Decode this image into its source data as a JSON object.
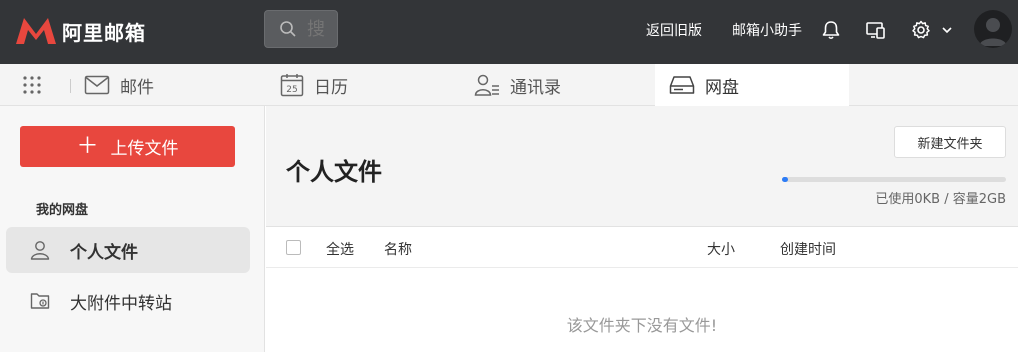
{
  "app": {
    "name": "阿里邮箱",
    "brand_color": "#e8473e"
  },
  "header": {
    "search_placeholder": "搜",
    "back_to_old": "返回旧版",
    "assistant": "邮箱小助手",
    "icons": [
      "bell-icon",
      "device-icon",
      "gear-icon",
      "chevron-down-icon",
      "avatar"
    ]
  },
  "tabs": [
    {
      "label": "邮件",
      "icon": "mail-icon"
    },
    {
      "label": "日历",
      "icon": "calendar-icon",
      "icon_text": "25"
    },
    {
      "label": "通讯录",
      "icon": "contacts-icon"
    },
    {
      "label": "网盘",
      "icon": "drive-icon",
      "active": true
    }
  ],
  "sidebar": {
    "upload_label": "上传文件",
    "section_label": "我的网盘",
    "items": [
      {
        "label": "个人文件",
        "icon": "user-icon",
        "active": true
      },
      {
        "label": "大附件中转站",
        "icon": "folder-transfer-icon"
      }
    ]
  },
  "main": {
    "title": "个人文件",
    "new_folder_label": "新建文件夹",
    "usage_text": "已使用0KB / 容量2GB",
    "usage_fraction": 0.01,
    "progress_color": "#2d7cf6",
    "columns": {
      "select_all": "全选",
      "name": "名称",
      "size": "大小",
      "created": "创建时间"
    },
    "empty_message": "该文件夹下没有文件!"
  }
}
